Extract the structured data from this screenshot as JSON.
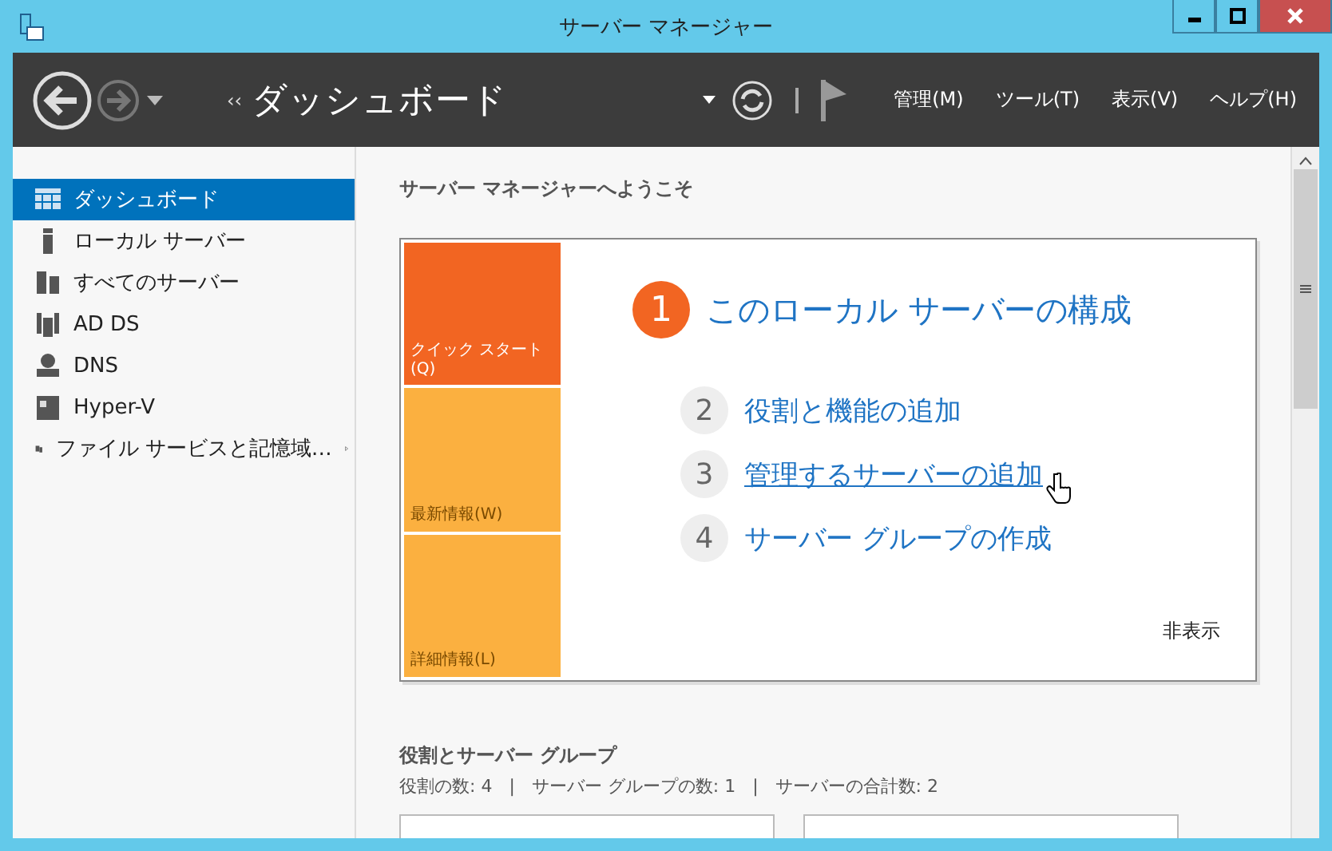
{
  "window": {
    "title": "サーバー マネージャー"
  },
  "toolbar": {
    "breadcrumb_arrows": "‹‹",
    "title": "ダッシュボード",
    "menus": [
      "管理(M)",
      "ツール(T)",
      "表示(V)",
      "ヘルプ(H)"
    ]
  },
  "sidebar": {
    "items": [
      {
        "label": "ダッシュボード",
        "selected": true,
        "has_submenu": false
      },
      {
        "label": "ローカル サーバー",
        "selected": false,
        "has_submenu": false
      },
      {
        "label": "すべてのサーバー",
        "selected": false,
        "has_submenu": false
      },
      {
        "label": "AD DS",
        "selected": false,
        "has_submenu": false
      },
      {
        "label": "DNS",
        "selected": false,
        "has_submenu": false
      },
      {
        "label": "Hyper-V",
        "selected": false,
        "has_submenu": false
      },
      {
        "label": "ファイル サービスと記憶域…",
        "selected": false,
        "has_submenu": true
      }
    ]
  },
  "welcome": {
    "heading": "サーバー マネージャーへようこそ",
    "tiles": [
      {
        "label": "クイック スタート\n(Q)",
        "selected": true
      },
      {
        "label": "最新情報(W)",
        "selected": false
      },
      {
        "label": "詳細情報(L)",
        "selected": false
      }
    ],
    "main_step": {
      "number": "1",
      "label": "このローカル サーバーの構成"
    },
    "steps": [
      {
        "number": "2",
        "label": "役割と機能の追加",
        "hovered": false
      },
      {
        "number": "3",
        "label": "管理するサーバーの追加",
        "hovered": true
      },
      {
        "number": "4",
        "label": "サーバー グループの作成",
        "hovered": false
      }
    ],
    "hide_link": "非表示"
  },
  "roles": {
    "heading": "役割とサーバー グループ",
    "summary": "役割の数: 4   |   サーバー グループの数: 1   |   サーバーの合計数: 2"
  }
}
